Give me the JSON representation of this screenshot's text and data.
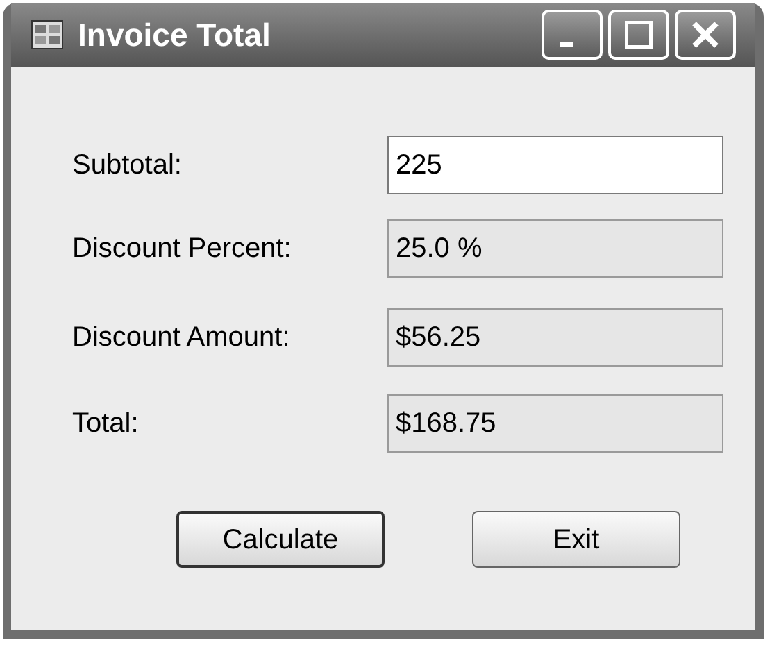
{
  "window": {
    "title": "Invoice Total"
  },
  "fields": [
    {
      "label": "Subtotal:",
      "value": "225",
      "readonly": false
    },
    {
      "label": "Discount Percent:",
      "value": "25.0 %",
      "readonly": true
    },
    {
      "label": "Discount Amount:",
      "value": "$56.25",
      "readonly": true
    },
    {
      "label": "Total:",
      "value": "$168.75",
      "readonly": true
    }
  ],
  "buttons": [
    {
      "label": "Calculate",
      "focused": true
    },
    {
      "label": "Exit",
      "focused": false
    }
  ]
}
